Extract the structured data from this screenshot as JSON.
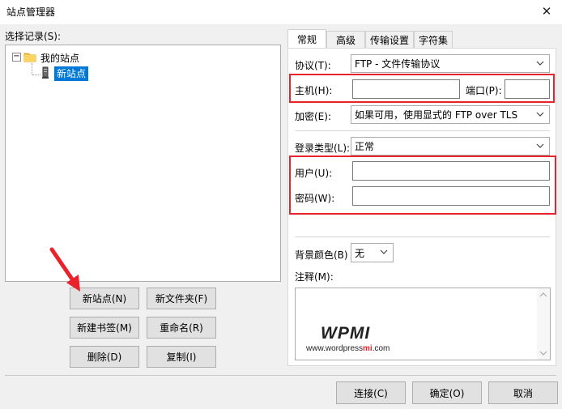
{
  "window": {
    "title": "站点管理器",
    "close": "✕"
  },
  "left": {
    "select_label": "选择记录(S):",
    "tree": {
      "root_label": "我的站点",
      "child_label": "新站点",
      "collapse_glyph": "−"
    },
    "buttons": {
      "new_site": "新站点(N)",
      "new_folder": "新文件夹(F)",
      "new_bookmark": "新建书签(M)",
      "rename": "重命名(R)",
      "delete": "删除(D)",
      "copy": "复制(I)"
    }
  },
  "tabs": [
    "常规",
    "高级",
    "传输设置",
    "字符集"
  ],
  "general": {
    "protocol_label": "协议(T):",
    "protocol_value": "FTP - 文件传输协议",
    "host_label": "主机(H):",
    "host_value": "",
    "port_label": "端口(P):",
    "port_value": "",
    "encryption_label": "加密(E):",
    "encryption_value": "如果可用，使用显式的 FTP over TLS",
    "logon_label": "登录类型(L):",
    "logon_value": "正常",
    "user_label": "用户(U):",
    "user_value": "",
    "password_label": "密码(W):",
    "password_value": "",
    "bgcolor_label": "背景颜色(B)",
    "bgcolor_value": "无",
    "comment_label": "注释(M):"
  },
  "watermark": {
    "logo": "WPMI",
    "url_start": "www.wordpress",
    "url_mi": "mi",
    "url_end": ".com"
  },
  "footer": {
    "connect": "连接(C)",
    "ok": "确定(O)",
    "cancel": "取消"
  },
  "colors": {
    "highlight_box": "#e8232c",
    "selection": "#0078d7",
    "arrow": "#e8232c"
  }
}
